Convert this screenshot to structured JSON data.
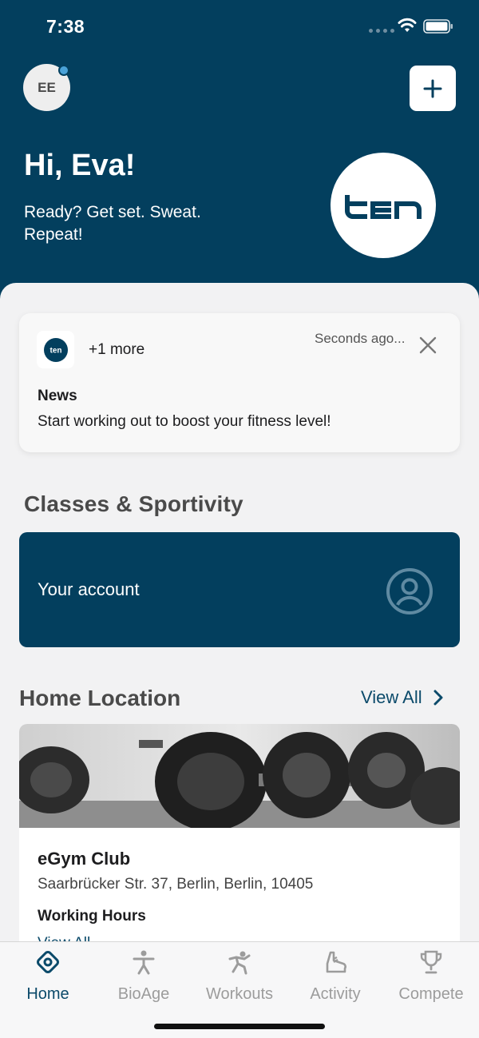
{
  "status_bar": {
    "time": "7:38"
  },
  "header": {
    "avatar_initials": "EE",
    "greeting": "Hi, Eva!",
    "tagline": "Ready? Get set. Sweat. Repeat!",
    "brand_logo_text": "ten",
    "colors": {
      "primary": "#033f5e",
      "accent_dot": "#4aa2d8"
    }
  },
  "notification": {
    "more": "+1 more",
    "time": "Seconds ago...",
    "title": "News",
    "body": "Start working out to boost your fitness level!"
  },
  "classes": {
    "title": "Classes & Sportivity",
    "account_label": "Your account"
  },
  "home_location": {
    "title": "Home Location",
    "view_all": "View All",
    "club_name": "eGym Club",
    "address": "Saarbrücker Str. 37, Berlin, Berlin, 10405",
    "working_hours": "Working Hours",
    "view_all_small": "View All"
  },
  "tabs": [
    {
      "label": "Home",
      "icon": "home-icon",
      "active": true
    },
    {
      "label": "BioAge",
      "icon": "bioage-icon",
      "active": false
    },
    {
      "label": "Workouts",
      "icon": "workouts-icon",
      "active": false
    },
    {
      "label": "Activity",
      "icon": "activity-icon",
      "active": false
    },
    {
      "label": "Compete",
      "icon": "trophy-icon",
      "active": false
    }
  ]
}
